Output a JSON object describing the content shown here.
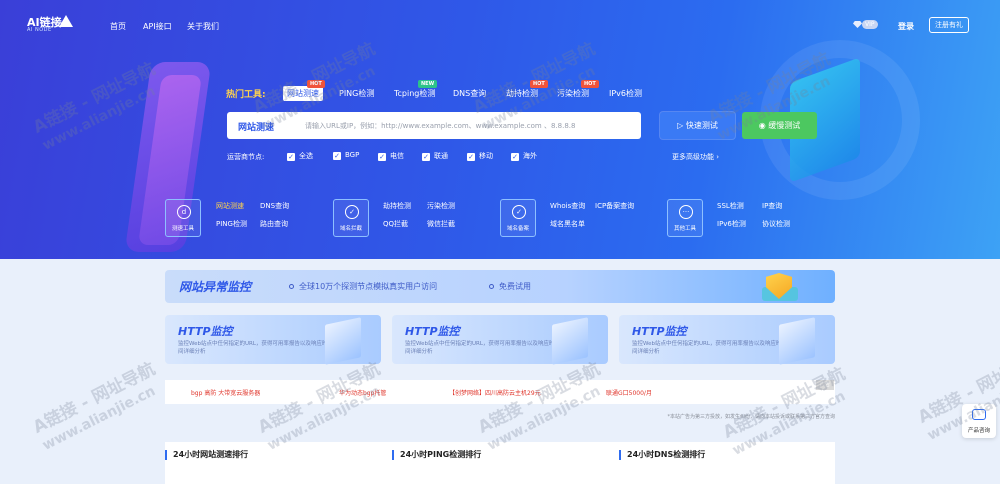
{
  "header": {
    "logo_text": "AI链接",
    "logo_sub": "AI NODE",
    "nav": [
      "首页",
      "API接口",
      "关于我们"
    ],
    "vip_label": "VIP",
    "login_label": "登录",
    "register_label": "注册有礼"
  },
  "hot_tools": {
    "label": "热门工具:",
    "tabs": [
      {
        "label": "网站测速",
        "badge": "HOT",
        "badge_color": "#f0533a",
        "active": true
      },
      {
        "label": "PING检测",
        "badge": "",
        "badge_color": "",
        "active": false
      },
      {
        "label": "Tcping检测",
        "badge": "NEW",
        "badge_color": "#2cc38a",
        "active": false
      },
      {
        "label": "DNS查询",
        "badge": "",
        "badge_color": "",
        "active": false
      },
      {
        "label": "劫持检测",
        "badge": "HOT",
        "badge_color": "#f0533a",
        "active": false
      },
      {
        "label": "污染检测",
        "badge": "HOT",
        "badge_color": "#f0533a",
        "active": false
      },
      {
        "label": "IPv6检测",
        "badge": "",
        "badge_color": "",
        "active": false
      }
    ]
  },
  "search": {
    "label": "网站测速",
    "placeholder": "请输入URL或IP，例如：http://www.example.com、www.example.com 、8.8.8.8",
    "quick_button": "快速测试",
    "slow_button": "缓慢测试"
  },
  "nodes": {
    "label": "运营商节点:",
    "options": [
      "全选",
      "BGP",
      "电信",
      "联通",
      "移动",
      "海外"
    ],
    "more_label": "更多高级功能"
  },
  "tool_groups": [
    {
      "icon": "speedometer-icon",
      "title": "测速工具",
      "links": [
        "网站测速",
        "DNS查询",
        "PING检测",
        "路由查询"
      ]
    },
    {
      "icon": "shield-check-icon",
      "title": "域名拦截",
      "links": [
        "劫持检测",
        "污染检测",
        "QQ拦截",
        "微信拦截"
      ]
    },
    {
      "icon": "shield-check-icon",
      "title": "域名备案",
      "links": [
        "Whois查询",
        "ICP备案查询",
        "域名黑名单"
      ]
    },
    {
      "icon": "more-dots-icon",
      "title": "其他工具",
      "links": [
        "SSL检测",
        "IP查询",
        "IPv6检测",
        "协议检测"
      ]
    }
  ],
  "monitor_banner": {
    "title": "网站异常监控",
    "points": [
      "全球10万个探测节点模拟真实用户访问",
      "免费试用"
    ]
  },
  "monitor_cards": [
    {
      "title": "HTTP监控",
      "desc": "监控Web站点中任何指定的URL，获得可用率报告以及响应时间详细分析"
    },
    {
      "title": "HTTP监控",
      "desc": "监控Web站点中任何指定的URL，获得可用率报告以及响应时间详细分析"
    },
    {
      "title": "HTTP监控",
      "desc": "监控Web站点中任何指定的URL，获得可用率报告以及响应时间详细分析"
    }
  ],
  "ads": {
    "items": [
      "bgp 高防 大带宽云服务器",
      "华为动态bgp托管",
      "【创梦网络】四川高防云主机29元",
      "联通G口5000/月"
    ],
    "tag": "广告",
    "disclaimer": "*本站广告为第三方投放，如发生纠纷，请向本站投诉或联系第三方官方查询"
  },
  "rankings": [
    "24小时网站测速排行",
    "24小时PING检测排行",
    "24小时DNS检测排行"
  ],
  "float_button": "产品咨询",
  "watermark": {
    "line1": "A链接 - 网址导航",
    "line2": "www.alianjie.cn"
  },
  "colors": {
    "primary": "#2f58e8",
    "accent_yellow": "#ffd34d",
    "green": "#4cc860",
    "hot": "#f0533a"
  }
}
